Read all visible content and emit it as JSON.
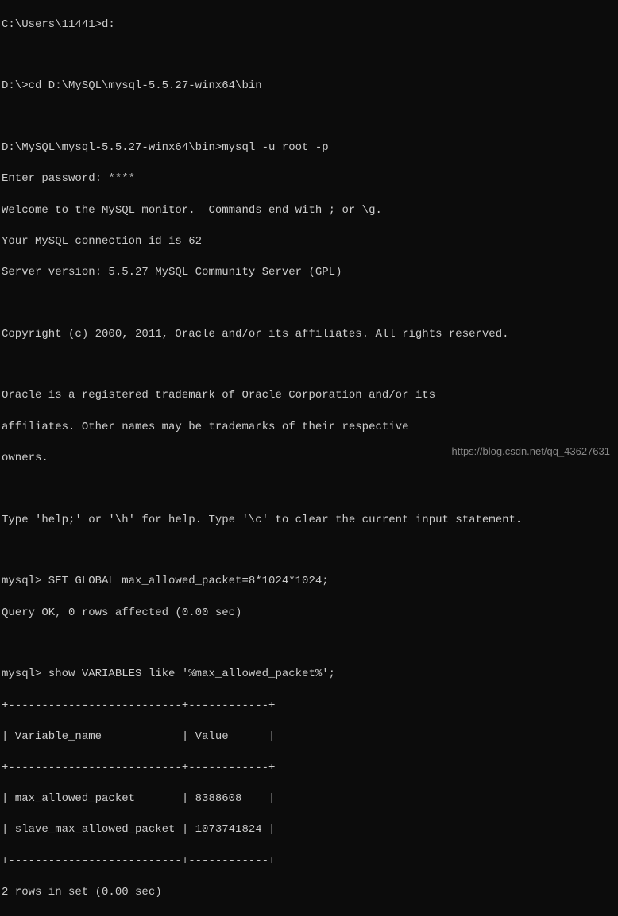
{
  "terminal": {
    "line1": "C:\\Users\\11441>d:",
    "line2": "",
    "line3": "D:\\>cd D:\\MySQL\\mysql-5.5.27-winx64\\bin",
    "line4": "",
    "line5": "D:\\MySQL\\mysql-5.5.27-winx64\\bin>mysql -u root -p",
    "line6": "Enter password: ****",
    "line7": "Welcome to the MySQL monitor.  Commands end with ; or \\g.",
    "line8": "Your MySQL connection id is 62",
    "line9": "Server version: 5.5.27 MySQL Community Server (GPL)",
    "line10": "",
    "line11": "Copyright (c) 2000, 2011, Oracle and/or its affiliates. All rights reserved.",
    "line12": "",
    "line13": "Oracle is a registered trademark of Oracle Corporation and/or its",
    "line14": "affiliates. Other names may be trademarks of their respective",
    "line15": "owners.",
    "line16": "",
    "line17": "Type 'help;' or '\\h' for help. Type '\\c' to clear the current input statement.",
    "line18": "",
    "line19": "mysql> SET GLOBAL max_allowed_packet=8*1024*1024;",
    "line20": "Query OK, 0 rows affected (0.00 sec)",
    "line21": "",
    "line22": "mysql> show VARIABLES like '%max_allowed_packet%';",
    "line23": "+--------------------------+------------+",
    "line24": "| Variable_name            | Value      |",
    "line25": "+--------------------------+------------+",
    "line26": "| max_allowed_packet       | 8388608    |",
    "line27": "| slave_max_allowed_packet | 1073741824 |",
    "line28": "+--------------------------+------------+",
    "line29": "2 rows in set (0.00 sec)"
  },
  "watermark": "https://blog.csdn.net/qq_43627631"
}
